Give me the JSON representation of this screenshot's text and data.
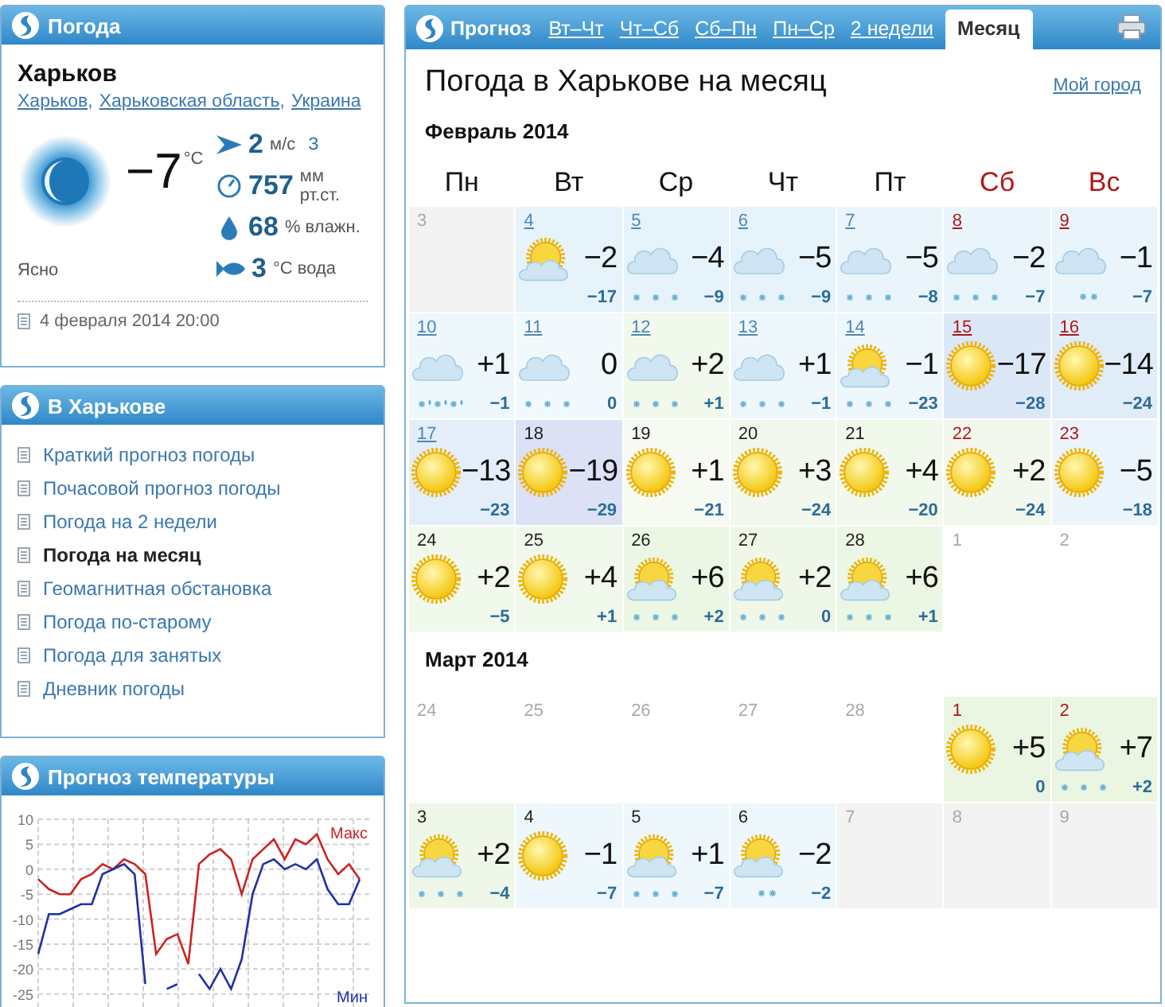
{
  "weather_panel": {
    "title": "Погода",
    "city": "Харьков",
    "location_links": [
      {
        "label": "Харьков",
        "separator": ","
      },
      {
        "label": "Харьковская область",
        "separator": ","
      },
      {
        "label": "Украина"
      }
    ],
    "temperature": "−7",
    "temperature_unit": "°C",
    "condition": "Ясно",
    "details": [
      {
        "kind": "wind",
        "value": "2",
        "unit": "м/с",
        "extra": "З"
      },
      {
        "kind": "pressure",
        "value": "757",
        "unit": "мм рт.ст."
      },
      {
        "kind": "humidity",
        "value": "68",
        "unit": "% влажн."
      },
      {
        "kind": "water",
        "value": "3",
        "unit": "°C вода"
      }
    ],
    "updated": "4 февраля 2014 20:00"
  },
  "city_menu": {
    "title": "В Харькове",
    "items": [
      {
        "label": "Краткий прогноз погоды",
        "selected": false
      },
      {
        "label": "Почасовой прогноз погоды",
        "selected": false
      },
      {
        "label": "Погода на 2 недели",
        "selected": false
      },
      {
        "label": "Погода на месяц",
        "selected": true
      },
      {
        "label": "Геомагнитная обстановка",
        "selected": false
      },
      {
        "label": "Погода по-старому",
        "selected": false
      },
      {
        "label": "Погода для занятых",
        "selected": false
      },
      {
        "label": "Дневник погоды",
        "selected": false
      }
    ]
  },
  "temperature_chart": {
    "title": "Прогноз температуры",
    "chart_data": {
      "type": "line",
      "grid": true,
      "ylim": [
        -27.6,
        10
      ],
      "yticks": [
        10,
        5,
        0,
        -5,
        -10,
        -15,
        -20,
        -25
      ],
      "series": [
        {
          "name": "Макс",
          "color": "#cc2222",
          "values": [
            -2,
            -4,
            -5,
            -5,
            -2,
            -1,
            1,
            0,
            2,
            1,
            -1,
            -17,
            -14,
            -13,
            -19,
            1,
            3,
            4,
            2,
            -5,
            2,
            4,
            6,
            2,
            6,
            5,
            7,
            2,
            -1,
            1,
            -2
          ]
        },
        {
          "name": "Мин",
          "color": "#1f2fa8",
          "values": [
            -17,
            -9,
            -9,
            -8,
            -7,
            -7,
            -1,
            0,
            1,
            -1,
            -23,
            null,
            -24,
            -23,
            null,
            -21,
            -24,
            -20,
            -24,
            -18,
            -5,
            1,
            2,
            0,
            1,
            0,
            2,
            -4,
            -7,
            -7,
            -2
          ]
        }
      ]
    }
  },
  "forecast": {
    "label": "Прогноз",
    "tabs": [
      {
        "label": "Вт–Чт",
        "selected": false
      },
      {
        "label": "Чт–Сб",
        "selected": false
      },
      {
        "label": "Сб–Пн",
        "selected": false
      },
      {
        "label": "Пн–Ср",
        "selected": false
      },
      {
        "label": "2 недели",
        "selected": false
      },
      {
        "label": "Месяц",
        "selected": true
      }
    ],
    "heading": "Погода в Харькове на месяц",
    "my_city_link": "Мой город",
    "weekdays": [
      {
        "label": "Пн",
        "weekend": false
      },
      {
        "label": "Вт",
        "weekend": false
      },
      {
        "label": "Ср",
        "weekend": false
      },
      {
        "label": "Чт",
        "weekend": false
      },
      {
        "label": "Пт",
        "weekend": false
      },
      {
        "label": "Сб",
        "weekend": true
      },
      {
        "label": "Вс",
        "weekend": true
      }
    ],
    "months": [
      {
        "title": "Февраль 2014",
        "weeks": [
          [
            {
              "day": "3",
              "kind": "past"
            },
            {
              "day": "4",
              "kind": "partly",
              "linked": true,
              "weekend": false,
              "high": "−2",
              "low": "−17",
              "color": "#e6f3fa"
            },
            {
              "day": "5",
              "kind": "cloud",
              "linked": true,
              "weekend": false,
              "precipitation": {
                "kind": "snow"
              },
              "high": "−4",
              "low": "−9",
              "color": "#e6f3fa"
            },
            {
              "day": "6",
              "kind": "cloud",
              "linked": true,
              "weekend": false,
              "precipitation": {
                "kind": "snow"
              },
              "high": "−5",
              "low": "−9",
              "color": "#e6f3fa"
            },
            {
              "day": "7",
              "kind": "cloud",
              "linked": true,
              "weekend": false,
              "precipitation": {
                "kind": "snow"
              },
              "high": "−5",
              "low": "−8",
              "color": "#e9f5fb"
            },
            {
              "day": "8",
              "kind": "cloud",
              "linked": true,
              "weekend": true,
              "precipitation": {
                "kind": "snow"
              },
              "high": "−2",
              "low": "−7",
              "color": "#e9f5fb"
            },
            {
              "day": "9",
              "kind": "cloud",
              "linked": true,
              "weekend": true,
              "precipitation": {
                "kind": "light"
              },
              "high": "−1",
              "low": "−7",
              "color": "#e9f5fb"
            }
          ],
          [
            {
              "day": "10",
              "kind": "cloud",
              "linked": true,
              "weekend": false,
              "precipitation": {
                "kind": "sleet"
              },
              "high": "+1",
              "low": "−1",
              "color": "#eef7fc"
            },
            {
              "day": "11",
              "kind": "cloud",
              "linked": true,
              "weekend": false,
              "precipitation": {
                "kind": "snow"
              },
              "high": "0",
              "low": "0",
              "color": "#f2f9fc"
            },
            {
              "day": "12",
              "kind": "cloud",
              "linked": true,
              "weekend": false,
              "precipitation": {
                "kind": "snow"
              },
              "high": "+2",
              "low": "+1",
              "color": "#f1f8ec"
            },
            {
              "day": "13",
              "kind": "cloud",
              "linked": true,
              "weekend": false,
              "precipitation": {
                "kind": "snow"
              },
              "high": "+1",
              "low": "−1",
              "color": "#eef7fc"
            },
            {
              "day": "14",
              "kind": "partly",
              "linked": true,
              "weekend": false,
              "precipitation": {
                "kind": "snow"
              },
              "high": "−1",
              "low": "−23",
              "color": "#eef7fc"
            },
            {
              "day": "15",
              "kind": "sun",
              "linked": true,
              "weekend": true,
              "high": "−17",
              "low": "−28",
              "color": "#dce8f8"
            },
            {
              "day": "16",
              "kind": "sun",
              "linked": true,
              "weekend": true,
              "high": "−14",
              "low": "−24",
              "color": "#e1ecf9"
            }
          ],
          [
            {
              "day": "17",
              "kind": "sun",
              "linked": true,
              "weekend": false,
              "high": "−13",
              "low": "−23",
              "color": "#e3eefa"
            },
            {
              "day": "18",
              "kind": "sun",
              "linked": false,
              "weekend": false,
              "high": "−19",
              "low": "−29",
              "color": "#dde1f6"
            },
            {
              "day": "19",
              "kind": "sun",
              "linked": false,
              "weekend": false,
              "high": "+1",
              "low": "−21",
              "color": "#f6faf3"
            },
            {
              "day": "20",
              "kind": "sun",
              "linked": false,
              "weekend": false,
              "high": "+3",
              "low": "−24",
              "color": "#f2f8ee"
            },
            {
              "day": "21",
              "kind": "sun",
              "linked": false,
              "weekend": false,
              "high": "+4",
              "low": "−20",
              "color": "#f1f8ec"
            },
            {
              "day": "22",
              "kind": "sun",
              "linked": false,
              "weekend": true,
              "high": "+2",
              "low": "−24",
              "color": "#f2f8ee"
            },
            {
              "day": "23",
              "kind": "sun",
              "linked": false,
              "weekend": true,
              "high": "−5",
              "low": "−18",
              "color": "#ecf5fb"
            }
          ],
          [
            {
              "day": "24",
              "kind": "sun",
              "linked": false,
              "weekend": false,
              "high": "+2",
              "low": "−5",
              "color": "#f1f8ec"
            },
            {
              "day": "25",
              "kind": "sun",
              "linked": false,
              "weekend": false,
              "high": "+4",
              "low": "+1",
              "color": "#f1f8ec"
            },
            {
              "day": "26",
              "kind": "partly",
              "linked": false,
              "weekend": false,
              "precipitation": {
                "kind": "snow"
              },
              "high": "+6",
              "low": "+2",
              "color": "#ecf6e4"
            },
            {
              "day": "27",
              "kind": "partly",
              "linked": false,
              "weekend": false,
              "precipitation": {
                "kind": "snow"
              },
              "high": "+2",
              "low": "0",
              "color": "#eff7e9"
            },
            {
              "day": "28",
              "kind": "partly",
              "linked": false,
              "weekend": false,
              "precipitation": {
                "kind": "snow"
              },
              "high": "+6",
              "low": "+1",
              "color": "#ecf6e4"
            },
            {
              "day": "1",
              "kind": "other"
            },
            {
              "day": "2",
              "kind": "other"
            }
          ]
        ]
      },
      {
        "title": "Март 2014",
        "weeks": [
          [
            {
              "day": "24",
              "kind": "other"
            },
            {
              "day": "25",
              "kind": "other"
            },
            {
              "day": "26",
              "kind": "other"
            },
            {
              "day": "27",
              "kind": "other"
            },
            {
              "day": "28",
              "kind": "other"
            },
            {
              "day": "1",
              "kind": "sun",
              "linked": false,
              "weekend": true,
              "high": "+5",
              "low": "0",
              "color": "#eaf6e1"
            },
            {
              "day": "2",
              "kind": "partly",
              "linked": false,
              "weekend": true,
              "precipitation": {
                "kind": "snow"
              },
              "high": "+7",
              "low": "+2",
              "color": "#eaf6e1"
            }
          ],
          [
            {
              "day": "3",
              "kind": "partly",
              "linked": false,
              "weekend": false,
              "precipitation": {
                "kind": "snow"
              },
              "high": "+2",
              "low": "−4",
              "color": "#eff7e9"
            },
            {
              "day": "4",
              "kind": "sun",
              "linked": false,
              "weekend": false,
              "high": "−1",
              "low": "−7",
              "color": "#eef7fc"
            },
            {
              "day": "5",
              "kind": "partly",
              "linked": false,
              "weekend": false,
              "precipitation": {
                "kind": "snow"
              },
              "high": "+1",
              "low": "−7",
              "color": "#eef7fc"
            },
            {
              "day": "6",
              "kind": "partly",
              "linked": false,
              "weekend": false,
              "precipitation": {
                "kind": "light"
              },
              "high": "−2",
              "low": "−2",
              "color": "#eef7fc"
            },
            {
              "day": "7",
              "kind": "past"
            },
            {
              "day": "8",
              "kind": "past"
            },
            {
              "day": "9",
              "kind": "past"
            }
          ]
        ]
      }
    ]
  }
}
